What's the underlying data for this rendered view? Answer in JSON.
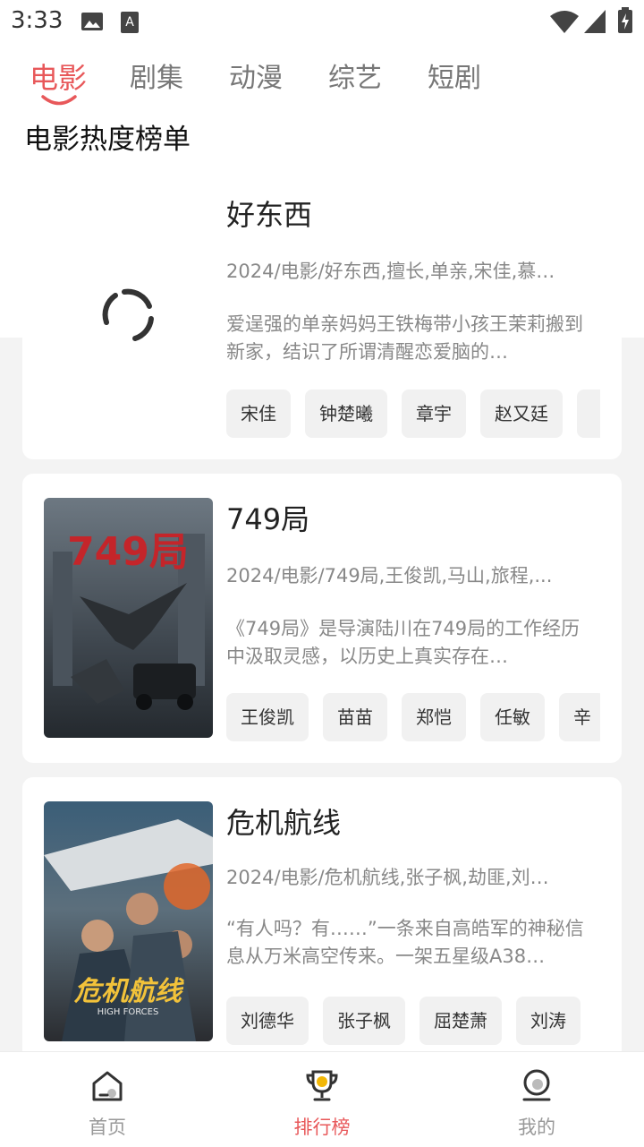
{
  "status_bar": {
    "time": "3:33"
  },
  "tabs": [
    {
      "label": "电影",
      "active": true
    },
    {
      "label": "剧集",
      "active": false
    },
    {
      "label": "动漫",
      "active": false
    },
    {
      "label": "综艺",
      "active": false
    },
    {
      "label": "短剧",
      "active": false
    }
  ],
  "section_title": "电影热度榜单",
  "movies": [
    {
      "title": "好东西",
      "meta": "2024/电影/好东西,擅长,单亲,宋佳,慕…",
      "desc": "爱逞强的单亲妈妈王铁梅带小孩王茉莉搬到新家，结识了所谓清醒恋爱脑的…",
      "tags": [
        "宋佳",
        "钟楚曦",
        "章宇",
        "赵又廷"
      ],
      "poster_loading": true
    },
    {
      "title": "749局",
      "meta": "2024/电影/749局,王俊凯,马山,旅程,...",
      "desc": "《749局》是导演陆川在749局的工作经历中汲取灵感，以历史上真实存在…",
      "tags": [
        "王俊凯",
        "苗苗",
        "郑恺",
        "任敏",
        "辛"
      ],
      "poster_text": "749局"
    },
    {
      "title": "危机航线",
      "meta": "2024/电影/危机航线,张子枫,劫匪,刘…",
      "desc": "“有人吗？有……”一条来自高皓军的神秘信息从万米高空传来。一架五星级A38…",
      "tags": [
        "刘德华",
        "张子枫",
        "屈楚萧",
        "刘涛"
      ],
      "poster_text": "危机航线",
      "poster_subtext": "HIGH FORCES"
    }
  ],
  "bottom_nav": [
    {
      "label": "首页",
      "active": false
    },
    {
      "label": "排行榜",
      "active": true
    },
    {
      "label": "我的",
      "active": false
    }
  ],
  "colors": {
    "accent": "#e8585a",
    "gold": "#f2b707"
  }
}
